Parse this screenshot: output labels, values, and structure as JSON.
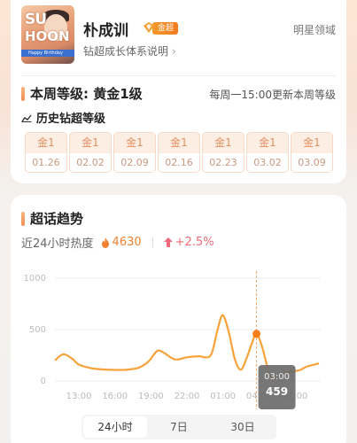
{
  "header": {
    "name": "朴成训",
    "badge": "金超",
    "subtitle": "钻超成长体系说明",
    "domain": "明星领域"
  },
  "avatar_caption": "Happy Birthday",
  "weekly": {
    "level_label": "本周等级: 黄金1级",
    "update_note": "每周一15:00更新本周等级",
    "history_title": "历史钻超等级",
    "weeks": [
      {
        "level": "金1",
        "date": "01.26"
      },
      {
        "level": "金1",
        "date": "02.02"
      },
      {
        "level": "金1",
        "date": "02.09"
      },
      {
        "level": "金1",
        "date": "02.16"
      },
      {
        "level": "金1",
        "date": "02.23"
      },
      {
        "level": "金1",
        "date": "03.02"
      },
      {
        "level": "金1",
        "date": "03.09"
      }
    ]
  },
  "trend": {
    "title": "超话趋势",
    "heat_label": "近24小时热度",
    "heat_value": "4630",
    "heat_change": "+2.5%",
    "tabs": [
      "24小时",
      "7日",
      "30日"
    ],
    "active_tab": 0,
    "tooltip_time": "03:00",
    "tooltip_value": "459"
  },
  "chart_data": {
    "type": "line",
    "y_ticks": [
      "1000",
      "500",
      "0"
    ],
    "ylim": [
      0,
      1000
    ],
    "x_ticks": [
      "13:00",
      "16:00",
      "19:00",
      "22:00",
      "01:00",
      "04:00",
      "07:00"
    ],
    "x_tick_positions": [
      2,
      5,
      8,
      11,
      14,
      17,
      20
    ],
    "x": [
      0,
      0.7,
      1.4,
      2,
      3,
      4,
      5,
      6,
      7,
      7.8,
      8.5,
      9,
      10,
      11,
      12,
      12.7,
      13.1,
      13.6,
      14,
      14.5,
      15,
      15.5,
      16,
      16.4,
      16.8,
      17.3,
      17.9,
      18.5,
      19,
      20,
      20.5,
      21,
      22
    ],
    "y": [
      200,
      260,
      220,
      160,
      125,
      112,
      108,
      110,
      130,
      190,
      290,
      280,
      210,
      230,
      240,
      230,
      280,
      520,
      640,
      470,
      210,
      110,
      230,
      360,
      459,
      320,
      60,
      30,
      70,
      95,
      110,
      140,
      170
    ],
    "highlight_index": 24,
    "colors": {
      "line": "#f7a23a",
      "marker": "#f77e15",
      "guide": "#f5a86a",
      "tooltip": "#6b6b6b"
    }
  }
}
